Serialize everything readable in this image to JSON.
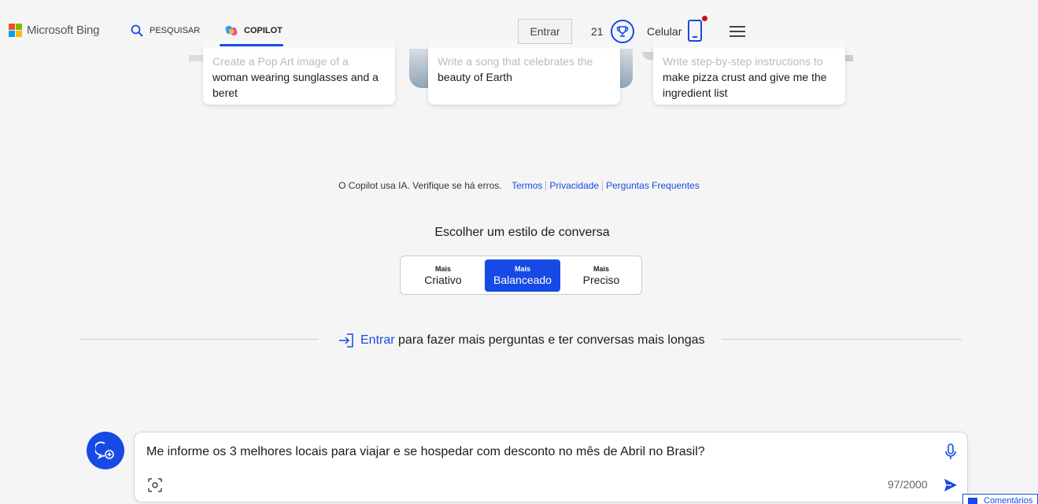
{
  "header": {
    "logo_text": "Microsoft Bing",
    "nav": [
      {
        "label": "PESQUISAR"
      },
      {
        "label": "COPILOT"
      }
    ],
    "signin_label": "Entrar",
    "points": "21",
    "mobile_label": "Celular"
  },
  "cards": [
    {
      "faded": "Create a Pop Art image of a",
      "main": "woman wearing sunglasses and a beret"
    },
    {
      "faded": "Write a song that celebrates the",
      "main": "beauty of Earth"
    },
    {
      "faded": "Write step-by-step instructions to",
      "main": "make pizza crust and give me the ingredient list"
    }
  ],
  "disclaimer": {
    "text": "O Copilot usa IA. Verifique se há erros.",
    "links": [
      "Termos",
      "Privacidade",
      "Perguntas Frequentes"
    ]
  },
  "conversation_style": {
    "title": "Escolher um estilo de conversa",
    "options": [
      {
        "small": "Mais",
        "big": "Criativo",
        "selected": false
      },
      {
        "small": "Mais",
        "big": "Balanceado",
        "selected": true
      },
      {
        "small": "Mais",
        "big": "Preciso",
        "selected": false
      }
    ]
  },
  "signin_prompt": {
    "link": "Entrar",
    "text": "para fazer mais perguntas e ter conversas mais longas"
  },
  "composer": {
    "value": "Me informe os 3 melhores locais para viajar e se hospedar com desconto no mês de Abril no Brasil?",
    "counter": "97/2000"
  },
  "feedback_label": "Comentários",
  "colors": {
    "accent": "#174ae4",
    "background": "#f5f5f5",
    "notification": "#c50f1f"
  },
  "icons": [
    "search-icon",
    "copilot-icon",
    "trophy-icon",
    "phone-icon",
    "menu-icon",
    "signin-arrow-icon",
    "new-topic-icon",
    "mic-icon",
    "image-search-icon",
    "send-icon"
  ]
}
